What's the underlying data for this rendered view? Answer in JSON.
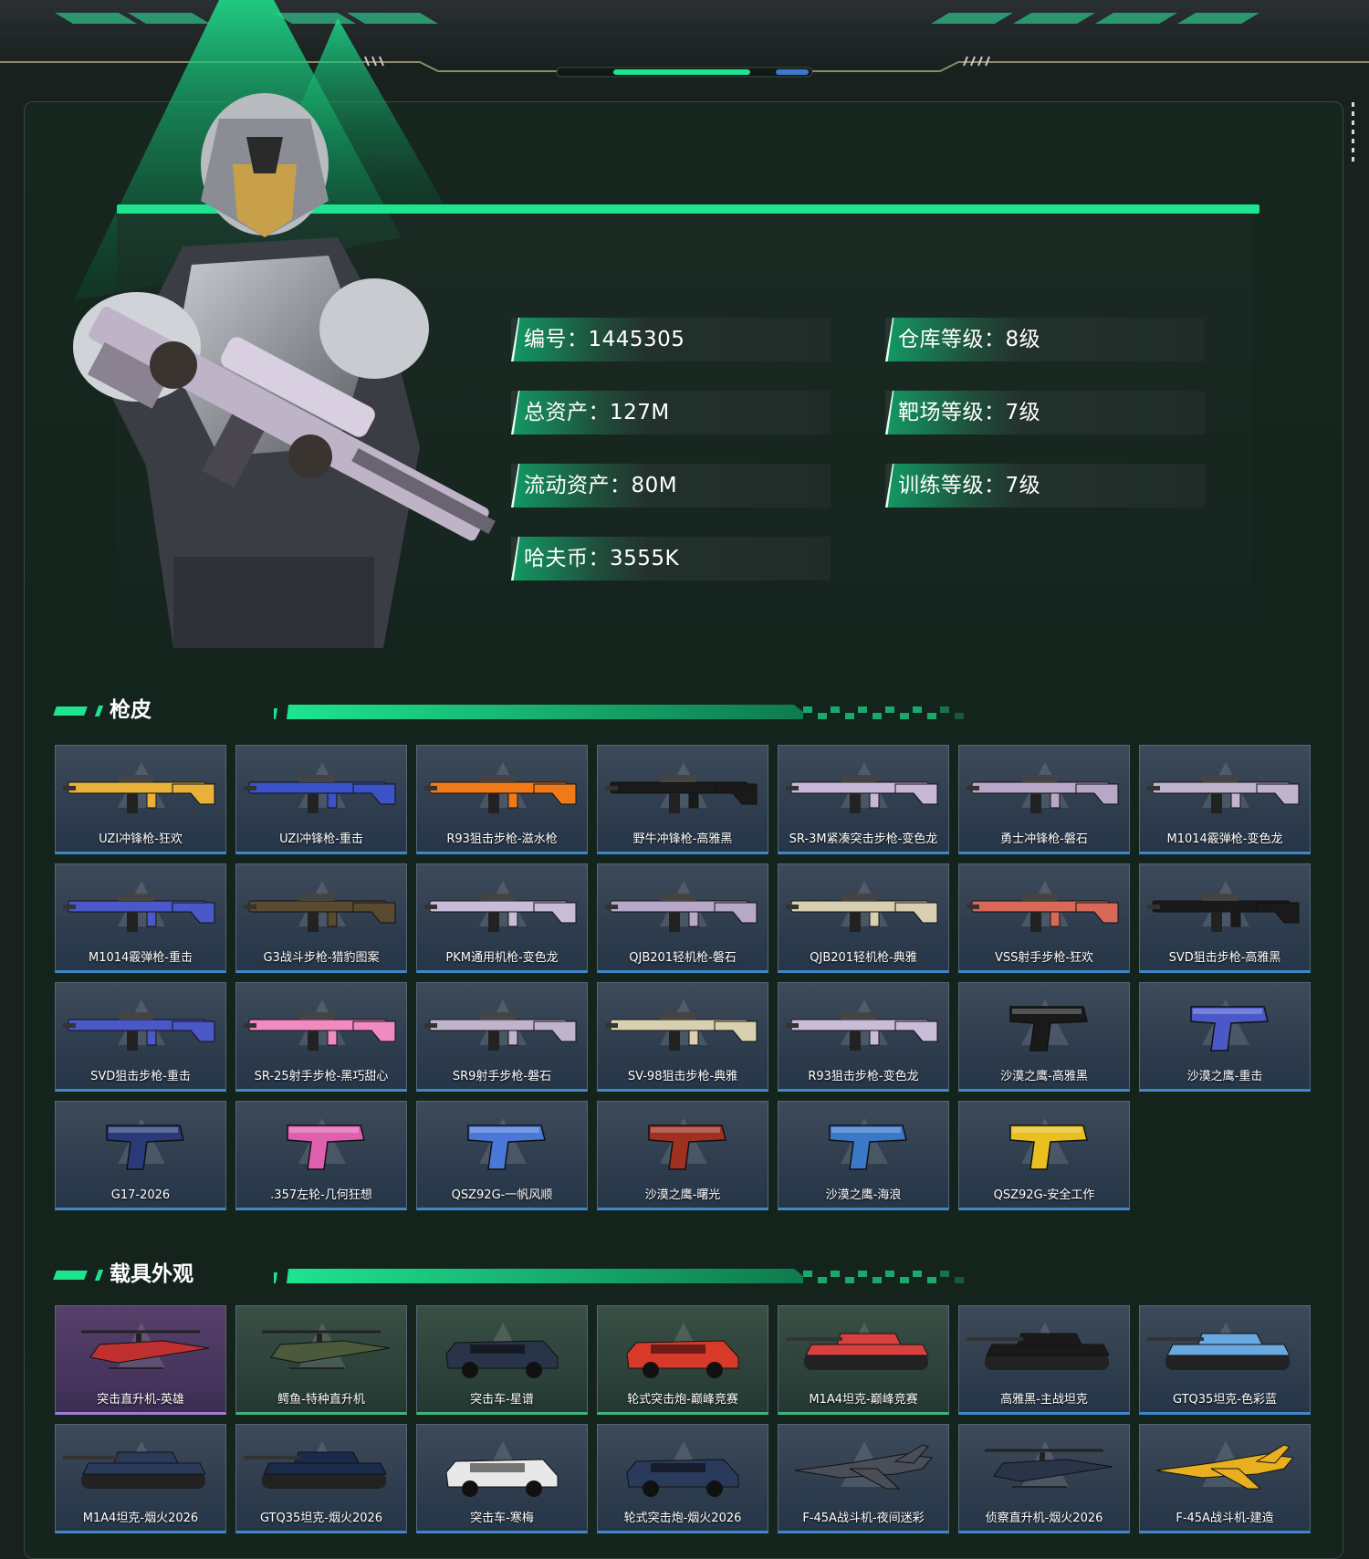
{
  "profile": {
    "stats": [
      {
        "label": "编号",
        "value": "1445305"
      },
      {
        "label": "仓库等级",
        "value": "8级"
      },
      {
        "label": "总资产",
        "value": "127M"
      },
      {
        "label": "靶场等级",
        "value": "7级"
      },
      {
        "label": "流动资产",
        "value": "80M"
      },
      {
        "label": "训练等级",
        "value": "7级"
      },
      {
        "label": "哈夫币",
        "value": "3555K"
      }
    ]
  },
  "gun_skins": {
    "title": "枪皮",
    "items": [
      {
        "label": "UZI冲锋枪-狂欢",
        "color": "#e8b23a"
      },
      {
        "label": "UZI冲锋枪-重击",
        "color": "#3b52c8"
      },
      {
        "label": "R93狙击步枪-滋水枪",
        "color": "#f07a18"
      },
      {
        "label": "野牛冲锋枪-高雅黑",
        "color": "#1a1a1a"
      },
      {
        "label": "SR-3M紧凑突击步枪-变色龙",
        "color": "#c8b8d8"
      },
      {
        "label": "勇士冲锋枪-磐石",
        "color": "#b8a8c8"
      },
      {
        "label": "M1014霰弹枪-变色龙",
        "color": "#c0b4cc"
      },
      {
        "label": "M1014霰弹枪-重击",
        "color": "#4a58c8"
      },
      {
        "label": "G3战斗步枪-猎豹图案",
        "color": "#5a4a30"
      },
      {
        "label": "PKM通用机枪-变色龙",
        "color": "#c8bcd8"
      },
      {
        "label": "QJB201轻机枪-磐石",
        "color": "#b8a8c8"
      },
      {
        "label": "QJB201轻机枪-典雅",
        "color": "#d8cfb0"
      },
      {
        "label": "VSS射手步枪-狂欢",
        "color": "#d86858"
      },
      {
        "label": "SVD狙击步枪-高雅黑",
        "color": "#1a1a1a"
      },
      {
        "label": "SVD狙击步枪-重击",
        "color": "#4a58c8"
      },
      {
        "label": "SR-25射手步枪-黑巧甜心",
        "color": "#f08ac0"
      },
      {
        "label": "SR9射手步枪-磐石",
        "color": "#c0b4cc"
      },
      {
        "label": "SV-98狙击步枪-典雅",
        "color": "#d8d0b0"
      },
      {
        "label": "R93狙击步枪-变色龙",
        "color": "#c8bcd8"
      },
      {
        "label": "沙漠之鹰-高雅黑",
        "color": "#1a1a1a"
      },
      {
        "label": "沙漠之鹰-重击",
        "color": "#4a58c8"
      },
      {
        "label": "G17-2026",
        "color": "#2a3a78"
      },
      {
        "label": ".357左轮-几何狂想",
        "color": "#e060b0"
      },
      {
        "label": "QSZ92G-一帆风顺",
        "color": "#4a78d8"
      },
      {
        "label": "沙漠之鹰-曙光",
        "color": "#a03020"
      },
      {
        "label": "沙漠之鹰-海浪",
        "color": "#3a78c8"
      },
      {
        "label": "QSZ92G-安全工作",
        "color": "#e8c020"
      }
    ]
  },
  "vehicle_skins": {
    "title": "载具外观",
    "items": [
      {
        "label": "突击直升机-英雄",
        "color": "#c03030"
      },
      {
        "label": "鳄鱼-特种直升机",
        "color": "#4a5a3a"
      },
      {
        "label": "突击车-星谱",
        "color": "#2a3448"
      },
      {
        "label": "轮式突击炮-巅峰竞赛",
        "color": "#d83a2a"
      },
      {
        "label": "M1A4坦克-巅峰竞赛",
        "color": "#d84040"
      },
      {
        "label": "高雅黑-主战坦克",
        "color": "#1a1a1a"
      },
      {
        "label": "GTQ35坦克-色彩蓝",
        "color": "#6aa8e0"
      },
      {
        "label": "M1A4坦克-烟火2026",
        "color": "#2a3a5a"
      },
      {
        "label": "GTQ35坦克-烟火2026",
        "color": "#1a2a4a"
      },
      {
        "label": "突击车-寒梅",
        "color": "#e8e8e8"
      },
      {
        "label": "轮式突击炮-烟火2026",
        "color": "#2a3a5a"
      },
      {
        "label": "F-45A战斗机-夜间迷彩",
        "color": "#4a4e58"
      },
      {
        "label": "侦察直升机-烟火2026",
        "color": "#2a3448"
      },
      {
        "label": "F-45A战斗机-建造",
        "color": "#e8b020"
      }
    ]
  }
}
